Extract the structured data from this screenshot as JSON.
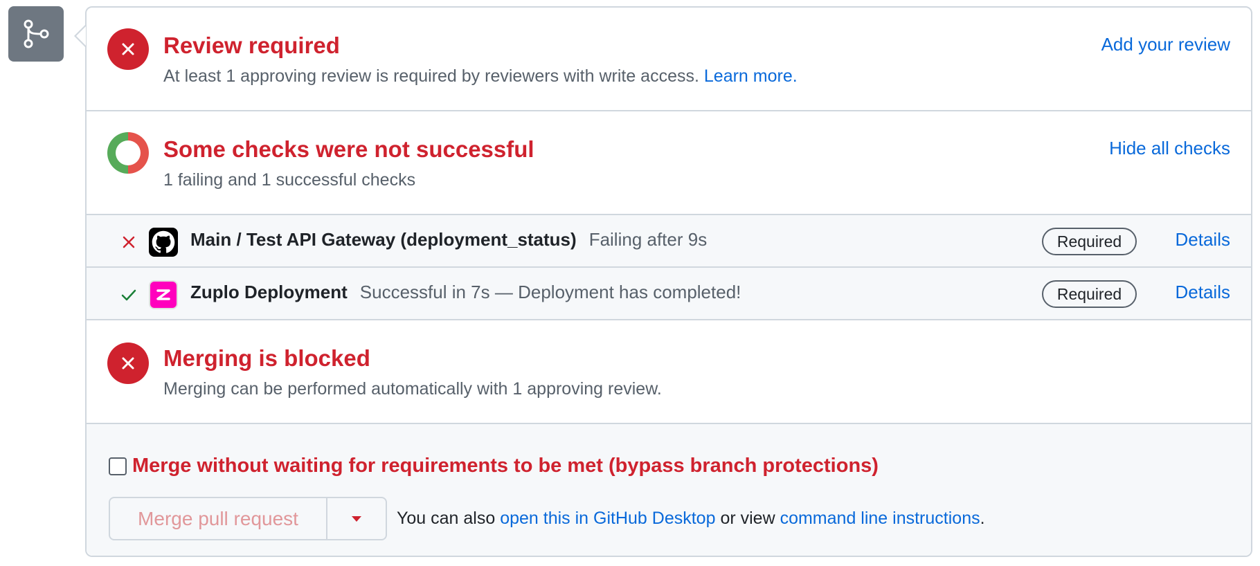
{
  "review": {
    "title": "Review required",
    "description": "At least 1 approving review is required by reviewers with write access.",
    "learn_more": "Learn more.",
    "action": "Add your review"
  },
  "checks": {
    "title": "Some checks were not successful",
    "summary": "1 failing and 1 successful checks",
    "action": "Hide all checks",
    "items": [
      {
        "status": "failure",
        "status_icon": "x-icon",
        "logo": "github-icon",
        "name": "Main / Test API Gateway (deployment_status)",
        "description": "Failing after 9s",
        "badge": "Required",
        "action": "Details"
      },
      {
        "status": "success",
        "status_icon": "check-icon",
        "logo": "zuplo-icon",
        "name": "Zuplo Deployment",
        "description": "Successful in 7s — Deployment has completed!",
        "badge": "Required",
        "action": "Details"
      }
    ]
  },
  "merge_status": {
    "title": "Merging is blocked",
    "description": "Merging can be performed automatically with 1 approving review."
  },
  "actions": {
    "bypass_label": "Merge without waiting for requirements to be met (bypass branch protections)",
    "bypass_checked": false,
    "merge_button": "Merge pull request",
    "also_prefix": "You can also",
    "desktop_link": "open this in GitHub Desktop",
    "also_middle": "or view",
    "cli_link": "command line instructions",
    "also_suffix": "."
  },
  "colors": {
    "danger": "#cf222e",
    "success": "#2da44e",
    "link": "#0969da",
    "muted": "#57606a",
    "border": "#d0d7de"
  }
}
